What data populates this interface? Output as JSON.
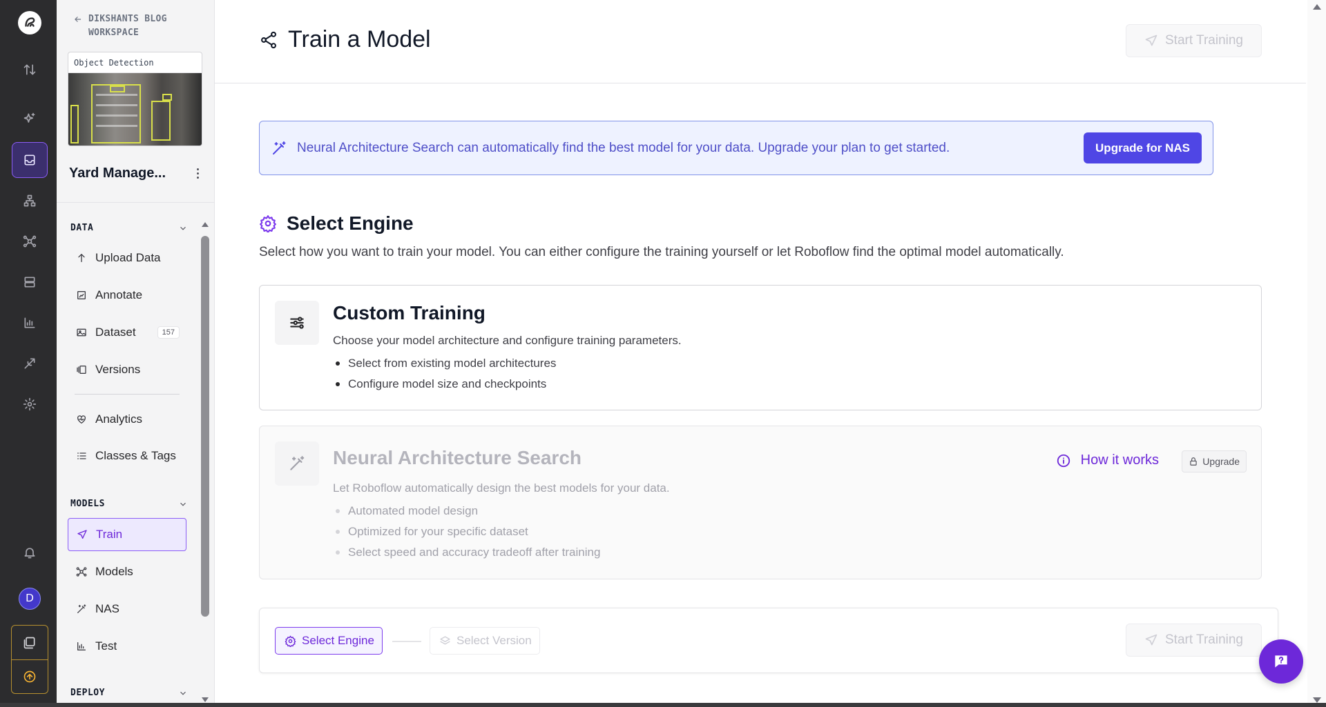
{
  "workspace": {
    "back_label": "DIKSHANTS BLOG WORKSPACE",
    "project_type": "Object Detection",
    "project_name": "Yard Manage..."
  },
  "rail": {
    "avatar_initial": "D",
    "icons": [
      "roboflow-logo-icon",
      "transfer-icon",
      "sparkles-icon",
      "inbox-icon",
      "hierarchy-icon",
      "graph-icon",
      "server-icon",
      "bar-chart-icon",
      "telescope-icon",
      "settings-icon",
      "bell-icon",
      "stack-icon",
      "upload-icon"
    ]
  },
  "sidebar": {
    "data_section": "DATA",
    "data_items": [
      {
        "label": "Upload Data",
        "icon": "arrow-up-icon"
      },
      {
        "label": "Annotate",
        "icon": "annotate-icon"
      },
      {
        "label": "Dataset",
        "icon": "image-icon",
        "badge": "157"
      },
      {
        "label": "Versions",
        "icon": "versions-icon"
      },
      {
        "label": "Analytics",
        "icon": "heart-pulse-icon"
      },
      {
        "label": "Classes & Tags",
        "icon": "list-icon"
      }
    ],
    "models_section": "MODELS",
    "model_items": [
      {
        "label": "Train",
        "icon": "train-icon",
        "active": true
      },
      {
        "label": "Models",
        "icon": "graph-icon"
      },
      {
        "label": "NAS",
        "icon": "magic-wand-icon"
      },
      {
        "label": "Test",
        "icon": "chart-icon"
      }
    ],
    "deploy_section": "DEPLOY"
  },
  "header": {
    "title": "Train a Model",
    "start_training": "Start Training"
  },
  "banner": {
    "text": "Neural Architecture Search can automatically find the best model for your data. Upgrade your plan to get started.",
    "button": "Upgrade for NAS",
    "accent": "#4f46e5"
  },
  "engine": {
    "title": "Select Engine",
    "description": "Select how you want to train your model. You can either configure the training yourself or let Roboflow find the optimal model automatically."
  },
  "custom_training": {
    "title": "Custom Training",
    "subtitle": "Choose your model architecture and configure training parameters.",
    "bullets": [
      "Select from existing model architectures",
      "Configure model size and checkpoints"
    ]
  },
  "nas": {
    "title": "Neural Architecture Search",
    "how_it_works": "How it works",
    "upgrade": "Upgrade",
    "subtitle": "Let Roboflow automatically design the best models for your data.",
    "bullets": [
      "Automated model design",
      "Optimized for your specific dataset",
      "Select speed and accuracy tradeoff after training"
    ]
  },
  "stepper": {
    "step1": "Select Engine",
    "step2": "Select Version",
    "start_training": "Start Training"
  },
  "colors": {
    "brand_purple": "#6d28d9",
    "rail_bg": "#2c2c2e"
  }
}
